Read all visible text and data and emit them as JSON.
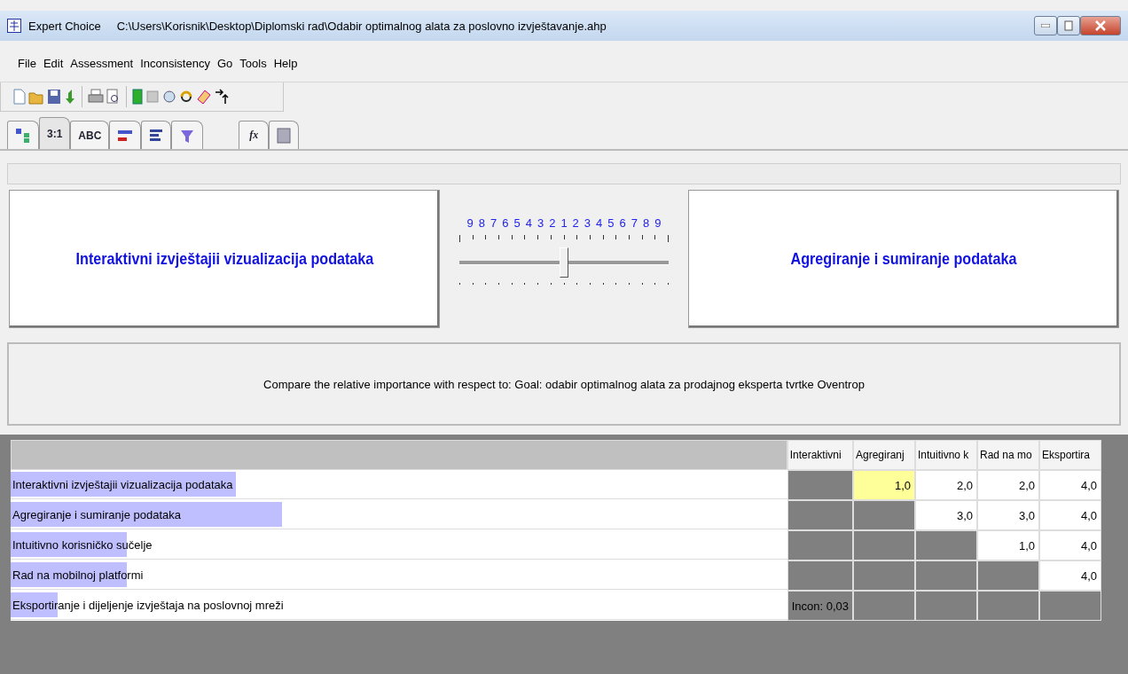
{
  "window": {
    "app": "Expert Choice",
    "path": "C:\\Users\\Korisnik\\Desktop\\Diplomski rad\\Odabir optimalnog alata za poslovno izvještavanje.ahp"
  },
  "menu": [
    "File",
    "Edit",
    "Assessment",
    "Inconsistency",
    "Go",
    "Tools",
    "Help"
  ],
  "tabs": [
    {
      "selected": false
    },
    {
      "label": "3:1",
      "selected": true
    },
    {
      "label": "ABC",
      "selected": false
    },
    {
      "selected": false
    },
    {
      "selected": false
    },
    {
      "selected": false
    },
    {
      "label": "fx",
      "selected": false
    },
    {
      "selected": false
    }
  ],
  "comparison": {
    "left": "Interaktivni izvještajii vizualizacija podataka",
    "right": "Agregiranje i sumiranje podataka",
    "scale": [
      "9",
      "8",
      "7",
      "6",
      "5",
      "4",
      "3",
      "2",
      "1",
      "2",
      "3",
      "4",
      "5",
      "6",
      "7",
      "8",
      "9"
    ],
    "level": 0.5
  },
  "prompt": "Compare the relative importance with respect to: Goal: odabir optimalnog alata za prodajnog eksperta tvrtke Oventrop",
  "table": {
    "columns": [
      "Interaktivni",
      "Agregiranj",
      "Intuitivno k",
      "Rad na mo",
      "Eksportira"
    ],
    "rows": [
      {
        "name": "Interaktivni izvještajii vizualizacija podataka",
        "level": 0.29,
        "cells": [
          {
            "kind": "shaded"
          },
          {
            "kind": "value",
            "value": "1,0",
            "selected": true
          },
          {
            "kind": "value",
            "value": "2,0",
            "selected": false
          },
          {
            "kind": "value",
            "value": "2,0",
            "selected": false
          },
          {
            "kind": "value",
            "value": "4,0",
            "selected": false
          }
        ]
      },
      {
        "name": "Agregiranje i sumiranje podataka",
        "level": 0.35,
        "cells": [
          {
            "kind": "shaded"
          },
          {
            "kind": "shaded"
          },
          {
            "kind": "value",
            "value": "3,0",
            "selected": false
          },
          {
            "kind": "value",
            "value": "3,0",
            "selected": false
          },
          {
            "kind": "value",
            "value": "4,0",
            "selected": false
          }
        ]
      },
      {
        "name": "Intuitivno korisničko sučelje",
        "level": 0.15,
        "cells": [
          {
            "kind": "shaded"
          },
          {
            "kind": "shaded"
          },
          {
            "kind": "shaded"
          },
          {
            "kind": "value",
            "value": "1,0",
            "selected": false
          },
          {
            "kind": "value",
            "value": "4,0",
            "selected": false
          }
        ]
      },
      {
        "name": "Rad na mobilnoj platformi",
        "level": 0.15,
        "cells": [
          {
            "kind": "shaded"
          },
          {
            "kind": "shaded"
          },
          {
            "kind": "shaded"
          },
          {
            "kind": "shaded"
          },
          {
            "kind": "value",
            "value": "4,0",
            "selected": false
          }
        ]
      },
      {
        "name": "Eksportiranje i dijeljenje izvještaja na poslovnoj mreži",
        "level": 0.06,
        "cells": [
          {
            "kind": "note",
            "value": "Incon: 0,03"
          },
          {
            "kind": "shaded"
          },
          {
            "kind": "shaded"
          },
          {
            "kind": "shaded"
          },
          {
            "kind": "shaded"
          }
        ]
      }
    ]
  }
}
